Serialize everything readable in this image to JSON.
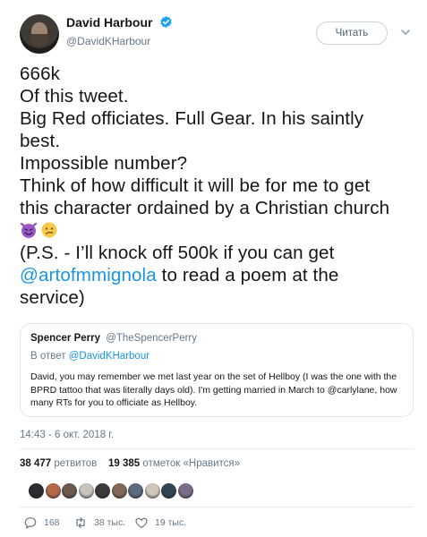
{
  "author": {
    "display_name": "David Harbour",
    "handle": "@DavidKHarbour",
    "verified": true
  },
  "follow_button": {
    "label": "Читать"
  },
  "tweet": {
    "lines": [
      "666k",
      "Of this tweet.",
      "Big Red officiates. Full Gear. In his saintly",
      "best.",
      "Impossible number?",
      "Think of how difficult it will be for me to get",
      "this character ordained by a Christian church",
      "(P.S. - I’ll knock off 500k if you can get",
      "@artofmmignola",
      " to read a poem at the",
      "service)"
    ],
    "emojis": [
      "smiling-imp-emoji",
      "confused-face-emoji"
    ]
  },
  "quoted_tweet": {
    "name": "Spencer Perry",
    "handle": "@TheSpencerPerry",
    "reply_prefix": "В ответ",
    "reply_to": "@DavidKHarbour",
    "body": "David, you may remember we met last year on the set of Hellboy (I was the one with the BPRD tattoo that was literally days old). I'm getting married in March to @carlylane, how many RTs for you to officiate as Hellboy."
  },
  "timestamp": "14:43 - 6 окт. 2018 г.",
  "stats": {
    "retweets_count": "38 477",
    "retweets_label": "ретвитов",
    "likes_count": "19 385",
    "likes_label": "отметок «Нравится»"
  },
  "liker_avatars": [
    "#2d2a30",
    "#b46a4a",
    "#6b5a4e",
    "#c9c3bd",
    "#3d3a3a",
    "#7f6a5a",
    "#5d6d7e",
    "#cfc8b8",
    "#334455",
    "#7a6e8a"
  ],
  "actions": {
    "replies": "168",
    "retweets": "38 тыс.",
    "likes": "19 тыс."
  },
  "colors": {
    "link": "#1b95e0",
    "secondary_text": "#657786",
    "verified": "#1da1f2"
  }
}
